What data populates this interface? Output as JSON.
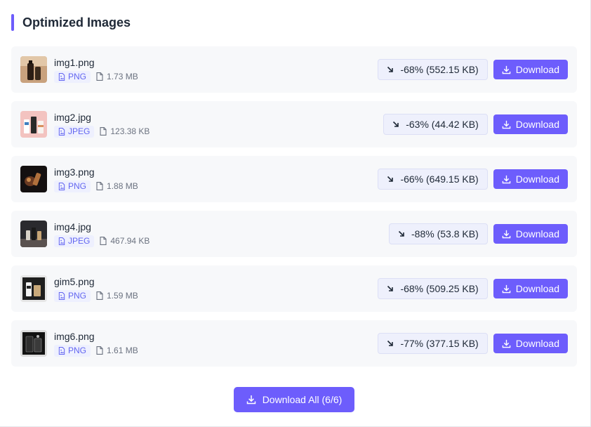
{
  "header": {
    "title": "Optimized Images"
  },
  "colors": {
    "accent": "#6d5dfc",
    "badge_text": "#6366f1",
    "row_bg": "#f7f8fa"
  },
  "icons": {
    "badge": "file-image-icon",
    "size": "file-icon",
    "reduction": "arrow-down-right-icon",
    "download": "download-icon"
  },
  "images": [
    {
      "filename": "img1.png",
      "format": "PNG",
      "size": "1.73 MB",
      "reduction": "-68% (552.15 KB)",
      "download_label": "Download"
    },
    {
      "filename": "img2.jpg",
      "format": "JPEG",
      "size": "123.38 KB",
      "reduction": "-63% (44.42 KB)",
      "download_label": "Download"
    },
    {
      "filename": "img3.png",
      "format": "PNG",
      "size": "1.88 MB",
      "reduction": "-66% (649.15 KB)",
      "download_label": "Download"
    },
    {
      "filename": "img4.jpg",
      "format": "JPEG",
      "size": "467.94 KB",
      "reduction": "-88% (53.8 KB)",
      "download_label": "Download"
    },
    {
      "filename": "gim5.png",
      "format": "PNG",
      "size": "1.59 MB",
      "reduction": "-68% (509.25 KB)",
      "download_label": "Download"
    },
    {
      "filename": "img6.png",
      "format": "PNG",
      "size": "1.61 MB",
      "reduction": "-77% (377.15 KB)",
      "download_label": "Download"
    }
  ],
  "footer": {
    "download_all_label": "Download All (6/6)"
  }
}
